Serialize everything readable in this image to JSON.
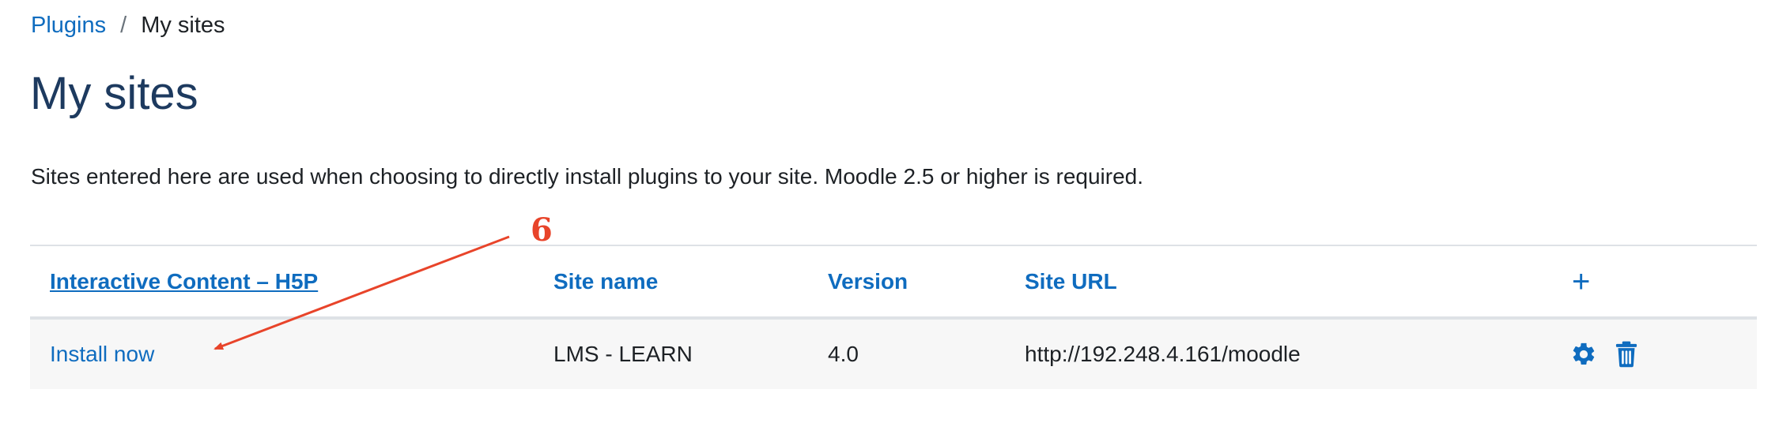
{
  "breadcrumb": {
    "items": [
      "Plugins",
      "My sites"
    ],
    "separator": "/"
  },
  "page_title": "My sites",
  "intro_text": "Sites entered here are used when choosing to directly install plugins to your site. Moodle 2.5 or higher is required.",
  "table": {
    "headers": {
      "plugin": "Interactive Content – H5P",
      "site_name": "Site name",
      "version": "Version",
      "site_url": "Site URL",
      "add": "+"
    },
    "rows": [
      {
        "action": "Install now",
        "site_name": "LMS - LEARN",
        "version": "4.0",
        "site_url": "http://192.248.4.161/moodle",
        "icons": [
          "gear-icon",
          "trash-icon"
        ]
      }
    ]
  },
  "annotation": {
    "label": "6",
    "color": "#e8442a"
  },
  "colors": {
    "link": "#0f6cbf",
    "title": "#1d3a5f",
    "row_bg": "#f7f7f7"
  }
}
